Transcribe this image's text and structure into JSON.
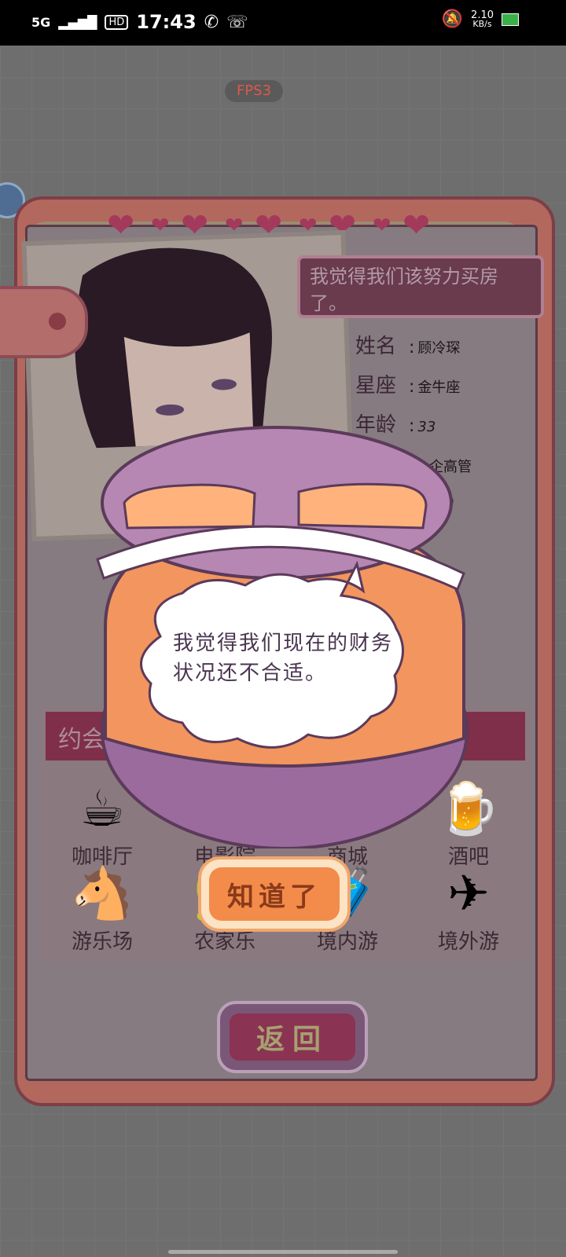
{
  "status_bar": {
    "network": "5G",
    "hd": "HD",
    "time": "17:43",
    "speed_value": "2.10",
    "speed_unit": "KB/s"
  },
  "fps_label": "FPS3",
  "character": {
    "speech": "我觉得我们该努力买房了。",
    "fields": [
      {
        "key": "姓名",
        "sep": ":",
        "value": "顾冷琛"
      },
      {
        "key": "星座",
        "sep": ":",
        "value": "金牛座"
      },
      {
        "key": "年龄",
        "sep": ":",
        "value": "33"
      }
    ],
    "partial_occupation": "企高管",
    "partial_value": "0"
  },
  "date_section": {
    "header_partial": "约会",
    "places": [
      {
        "name": "咖啡厅",
        "icon": "coffee-cup-icon",
        "glyph": "☕"
      },
      {
        "name": "电影院",
        "icon": "cinema-icon",
        "glyph": "🎬"
      },
      {
        "name": "商城",
        "icon": "mall-icon",
        "glyph": "🛍"
      },
      {
        "name": "酒吧",
        "icon": "beer-mug-icon",
        "glyph": "🍺"
      },
      {
        "name": "游乐场",
        "icon": "carousel-horse-icon",
        "glyph": "🐴"
      },
      {
        "name": "农家乐",
        "icon": "farmhouse-icon",
        "glyph": "🏡"
      },
      {
        "name": "境内游",
        "icon": "suitcase-icon",
        "glyph": "🧳"
      },
      {
        "name": "境外游",
        "icon": "airplane-icon",
        "glyph": "✈"
      }
    ]
  },
  "back_button_label": "返回",
  "dialog": {
    "message": "我觉得我们现在的财务状况还不合适。",
    "ok_label": "知道了"
  },
  "colors": {
    "card_border": "#7d3e47",
    "dialog_orange": "#f3955e",
    "dialog_purple": "#9b6b9e",
    "ok_button": "#f38b4b"
  }
}
